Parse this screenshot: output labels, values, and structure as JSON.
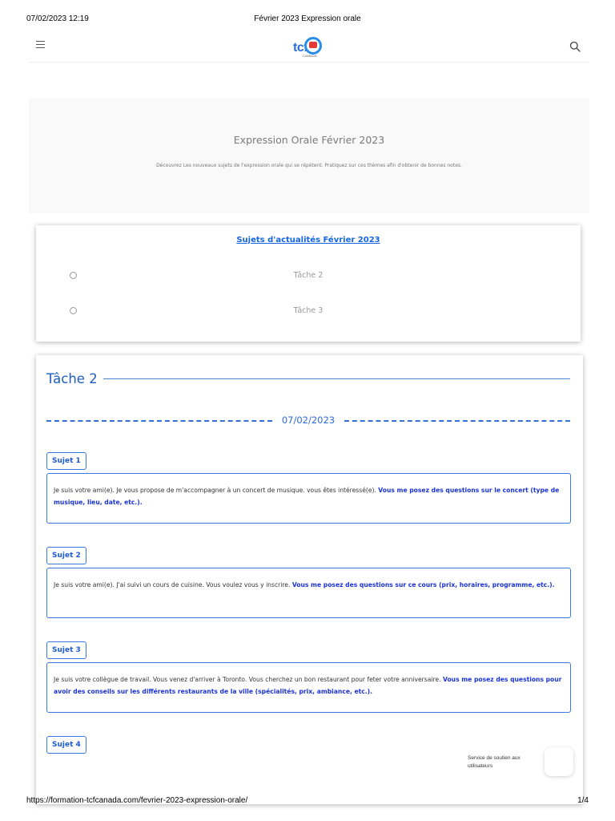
{
  "print_header": {
    "datetime": "07/02/2023 12:19",
    "title": "Février 2023 Expression orale"
  },
  "print_footer": {
    "url": "https://formation-tcfcanada.com/fevrier-2023-expression-orale/",
    "page": "1/4"
  },
  "nav": {
    "logo_text": "tcf",
    "logo_sub": "CANADA"
  },
  "hero": {
    "title": "Expression Orale Février 2023",
    "description": "Découvrez Les nouveaux sujets de l'expression orale qui se répètent. Pratiquez sur ces thèmes afin d'obtenir de bonnes notes."
  },
  "toc": {
    "heading": "Sujets d'actualités Février 2023",
    "items": [
      {
        "label": "Tâche 2"
      },
      {
        "label": "Tâche 3"
      }
    ]
  },
  "section": {
    "title": "Tâche 2",
    "date": "07/02/2023",
    "subjects": [
      {
        "label": "Sujet 1",
        "text": "Je suis votre ami(e). Je vous propose de m'accompagner à un concert de musique. vous êtes intéressé(e). ",
        "question": "Vous me posez des questions sur le concert (type de musique, lieu, date, etc.)."
      },
      {
        "label": "Sujet 2",
        "text": "Je suis votre ami(e). J'ai suivi un cours de cuisine. Vous voulez vous y inscrire. ",
        "question": "Vous me posez des questions sur ce cours (prix, horaires, programme, etc.)."
      },
      {
        "label": "Sujet 3",
        "text": "Je suis votre collègue de travail. Vous venez d'arriver à Toronto. Vous cherchez un bon restaurant pour feter votre anniversaire. ",
        "question": "Vous me posez des questions pour avoir des conseils sur les différents restaurants de la ville (spécialités, prix, ambiance, etc.)."
      },
      {
        "label": "Sujet 4"
      }
    ]
  },
  "support": {
    "text": "Service de soutien aux utilisateurs"
  },
  "colors": {
    "accent": "#1e5fc4",
    "highlight": "#1a33d8",
    "link": "#1565e0"
  }
}
